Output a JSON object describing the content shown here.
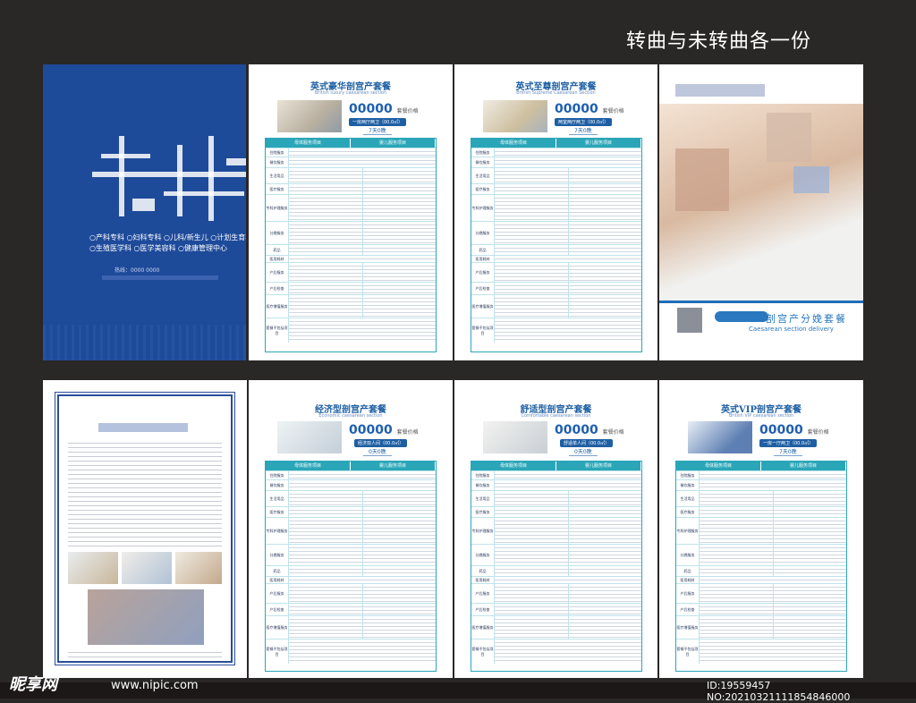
{
  "header": {
    "title": "转曲与未转曲各一份"
  },
  "cover": {
    "features": [
      "○产科专科 ○妇科专科 ○儿科/新生儿 ○计划生育科",
      "○生殖医学科 ○医学美容科 ○健康管理中心"
    ],
    "phone": "热线：0000 0000"
  },
  "pages": [
    {
      "title": "英式豪华剖宫产套餐",
      "subtitle": "British luxury caesarean section",
      "price": "00000",
      "price_label": "套餐价格",
      "price_small": "00000元",
      "pill": "一房两厅两卫（00.0㎡）",
      "days": "7天0晚"
    },
    {
      "title": "英式至尊剖宫产套餐",
      "subtitle": "British Supreme Caesarean Section",
      "price": "00000",
      "price_label": "套餐价格",
      "price_small": "00000元",
      "pill": "两室两厅两卫（00.0㎡）",
      "days": "7天0晚"
    },
    {
      "title": "经济型剖宫产套餐",
      "subtitle": "Economic caesarean section",
      "price": "00000",
      "price_label": "套餐价格",
      "price_small": "00000元",
      "pill": "经济双人间（00.0㎡）",
      "days": "0天0晚"
    },
    {
      "title": "舒适型剖宫产套餐",
      "subtitle": "Comfortable caesarean section",
      "price": "00000",
      "price_label": "套餐价格",
      "price_small": "00000元",
      "pill": "舒适单人间（00.0㎡）",
      "days": "0天0晚"
    },
    {
      "title": "英式VIP剖宫产套餐",
      "subtitle": "British VIP caesarean section",
      "price": "00000",
      "price_label": "套餐价格",
      "price_small": "00000元",
      "pill": "一房一厅两卫（00.0㎡）",
      "days": "7天0晚"
    }
  ],
  "table": {
    "col_mom": "母体服务项目",
    "col_baby": "婴儿服务项目",
    "rows": [
      "住院服务",
      "餐饮服务",
      "生活用品",
      "医疗服务",
      "专科护理服务",
      "分娩服务",
      "药品",
      "医用耗材",
      "产后服务",
      "产后检查",
      "医疗增值服务",
      "套餐不包括项目"
    ]
  },
  "brochure": {
    "brand": "剖宫产分娩套餐",
    "brand_en": "Caesarean section delivery"
  },
  "footer": {
    "logo": "昵享网",
    "site": "www.nipic.com",
    "id": "ID:19559457 NO:20210321111854846000"
  }
}
